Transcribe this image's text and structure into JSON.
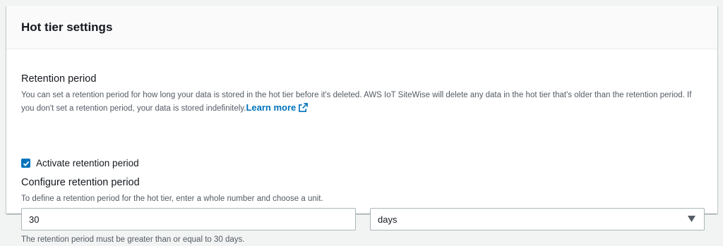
{
  "panel": {
    "title": "Hot tier settings"
  },
  "retention": {
    "heading": "Retention period",
    "description": "You can set a retention period for how long your data is stored in the hot tier before it's deleted. AWS IoT SiteWise will delete any data in the hot tier that's older than the retention period. If you don't set a retention period, your data is stored indefinitely.",
    "learn_more": "Learn more",
    "learn_more_icon": "external-link-icon",
    "checkbox_label": "Activate retention period",
    "checkbox_checked": true
  },
  "configure": {
    "heading": "Configure retention period",
    "description": "To define a retention period for the hot tier, enter a whole number and choose a unit.",
    "value": "30",
    "unit_selected": "days",
    "unit_icon": "caret-down-icon",
    "constraint": "The retention period must be greater than or equal to 30 days."
  },
  "colors": {
    "accent": "#0073bb",
    "text": "#16191f",
    "secondary_text": "#545b64",
    "border": "#aab7b8"
  }
}
